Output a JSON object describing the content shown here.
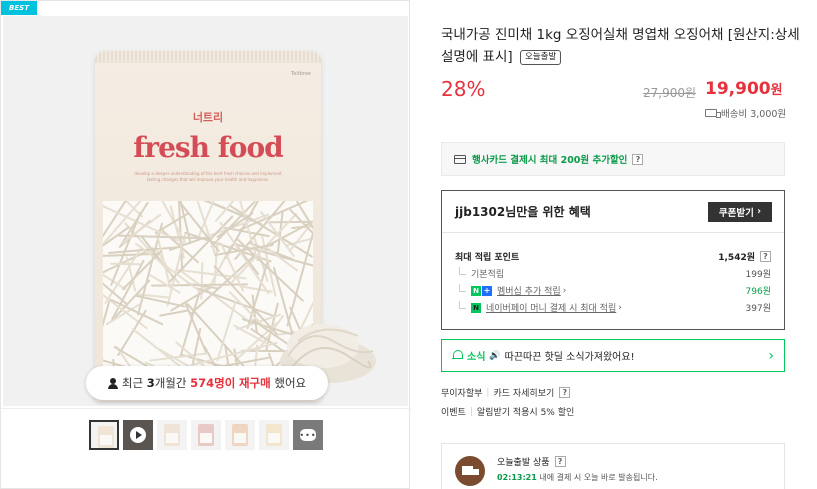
{
  "badge": "BEST",
  "product_image": {
    "bag_logo": "너트리",
    "bag_title": "fresh food",
    "bag_brand_tag": "Teltbree",
    "bag_desc": "develop a deeper understanding of the best fresh choices and implement lasting changes that will improve your health and happiness."
  },
  "repurchase": {
    "prefix": "최근",
    "months": "3",
    "months_unit": "개월간",
    "count": "574명이",
    "action": "재구매",
    "suffix": "했어요"
  },
  "thumbnails": [
    "product-1",
    "video",
    "product-2",
    "product-3",
    "product-4",
    "product-5",
    "more"
  ],
  "product": {
    "title": "국내가공 진미채 1kg 오징어실채 명엽채 오징어채 [원산지:상세설명에 표시]",
    "today_chip": "오늘출발",
    "discount": "28%",
    "original_price": "27,900원",
    "price": "19,900",
    "price_unit": "원",
    "shipping": "배송비 3,000원"
  },
  "card_benefit": {
    "text": "행사카드 결제시 최대 200원 추가할인",
    "help": "?"
  },
  "benefit": {
    "title": "jjb1302님만을 위한 혜택",
    "coupon_button": "쿠폰받기",
    "coupon_arrow": "›",
    "rows": [
      {
        "label": "최대 적립 포인트",
        "value": "1,542원",
        "help": "?"
      },
      {
        "label": "기본적립",
        "value": "199원"
      },
      {
        "label": "멤버십 추가 적립",
        "value": "796원",
        "badge_n": "N",
        "badge_plus": "+",
        "chevron": "›"
      },
      {
        "label": "네이버페이 머니 결제 시 최대 적립",
        "value": "397원",
        "badge_n": "N",
        "chevron": "›"
      }
    ]
  },
  "alert": {
    "label": "소식",
    "speaker": "🔊",
    "text": "따끈따끈 핫딜 소식가져왔어요!",
    "arrow": "›"
  },
  "info_lines": [
    {
      "a": "무이자할부",
      "b": "카드 자세히보기",
      "help": "?"
    },
    {
      "a": "이벤트",
      "b": "알림받기 적용시 5% 할인"
    }
  ],
  "today_shipping": {
    "title": "오늘출발 상품",
    "help": "?",
    "time": "02:13:21",
    "sub": "내에 결제 시 오늘 바로 발송됩니다."
  },
  "colors": {
    "sale_red": "#e5323d",
    "naver_green": "#03c75a",
    "badge_blue": "#00c1de",
    "bag_red": "#d44c56"
  }
}
